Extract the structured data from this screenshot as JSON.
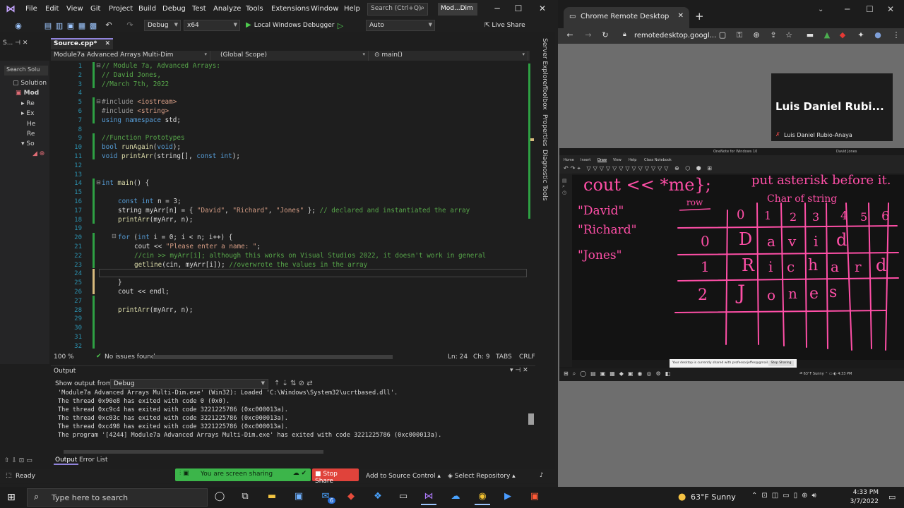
{
  "vs": {
    "menu": [
      "File",
      "Edit",
      "View",
      "Git",
      "Project",
      "Build",
      "Debug",
      "Test",
      "Analyze",
      "Tools",
      "Extensions",
      "Window",
      "Help"
    ],
    "search_placeholder": "Search (Ctrl+Q)",
    "solution_title": "Mod...Dim",
    "toolbar": {
      "config": "Debug",
      "platform": "x64",
      "run_label": "Local Windows Debugger",
      "auto": "Auto",
      "live_share": "Live Share"
    },
    "solution_tab": "S...",
    "source_tab": "Source.cpp*",
    "nav": {
      "project": "Module7a Advanced Arrays Multi-Dim",
      "scope": "(Global Scope)",
      "member": "main()"
    },
    "solution_search": "Search Solu",
    "tree": [
      "Solution",
      "Mod",
      "Re",
      "Ex",
      "He",
      "Re",
      "So"
    ],
    "side_tabs": [
      "Server Explorer",
      "Toolbox",
      "Properties",
      "Diagnostic Tools"
    ],
    "line_numbers": [
      "1",
      "2",
      "3",
      "4",
      "5",
      "6",
      "7",
      "8",
      "9",
      "10",
      "11",
      "12",
      "13",
      "14",
      "15",
      "16",
      "17",
      "18",
      "19",
      "20",
      "21",
      "22",
      "23",
      "24",
      "25",
      "26",
      "27",
      "28",
      "29",
      "30",
      "31",
      "32"
    ],
    "code": {
      "l1": "// Module 7a, Advanced Arrays:",
      "l2": "// David Jones,",
      "l3": "//March 7th, 2022",
      "l5a": "#include ",
      "l5b": "<iostream>",
      "l6a": "#include ",
      "l6b": "<string>",
      "l7a": "using namespace ",
      "l7b": "std;",
      "l9": "//Function Prototypes",
      "l10a": "bool ",
      "l10b": "runAgain",
      "l10c": "(",
      "l10d": "void",
      "l10e": ");",
      "l11a": "void ",
      "l11b": "printArr",
      "l11c": "(string[], ",
      "l11d": "const int",
      "l11e": ");",
      "l14a": "int ",
      "l14b": "main",
      "l14c": "() {",
      "l16a": "const int ",
      "l16b": "n = 3;",
      "l17a": "string myArr[n] = { ",
      "l17b": "\"David\"",
      "l17c": ", ",
      "l17d": "\"Richard\"",
      "l17e": ", ",
      "l17f": "\"Jones\"",
      "l17g": " }; ",
      "l17h": "// declared and instantiated the array",
      "l18a": "printArr",
      "l18b": "(myArr, n);",
      "l20a": "for ",
      "l20b": "(",
      "l20c": "int ",
      "l20d": "i = 0; i < n; i++) {",
      "l21a": "cout << ",
      "l21b": "\"Please enter a name: \"",
      "l21c": ";",
      "l22": "//cin >> myArr[i]; although this works on Visual Studios 2022, it doesn't work in general",
      "l23a": "getline",
      "l23b": "(cin, myArr[i]); ",
      "l23c": "//overwrote the values in the array",
      "l25": "}",
      "l26": "cout << endl;",
      "l28a": "printArr",
      "l28b": "(myArr, n);"
    },
    "editor_status": {
      "zoom": "100 %",
      "issues": "No issues found",
      "ln": "Ln: 24",
      "ch": "Ch: 9",
      "tabs": "TABS",
      "crlf": "CRLF"
    },
    "output": {
      "title": "Output",
      "show_from_label": "Show output from:",
      "source": "Debug",
      "lines": [
        "'Module7a Advanced Arrays Multi-Dim.exe' (Win32): Loaded 'C:\\Windows\\System32\\ucrtbased.dll'.",
        "The thread 0x90e8 has exited with code 0 (0x0).",
        "The thread 0xc9c4 has exited with code 3221225786 (0xc000013a).",
        "The thread 0xc03c has exited with code 3221225786 (0xc000013a).",
        "The thread 0xc498 has exited with code 3221225786 (0xc000013a).",
        "The program '[4244] Module7a Advanced Arrays Multi-Dim.exe' has exited with code 3221225786 (0xc000013a)."
      ],
      "tab_output": "Output",
      "tab_errors": "Error List"
    },
    "status": {
      "ready": "Ready",
      "sharing": "You are screen sharing",
      "stop_share": "Stop Share",
      "add_source": "Add to Source Control",
      "select_repo": "Select Repository"
    }
  },
  "chrome": {
    "tab_title": "Chrome Remote Desktop",
    "url": "remotedesktop.googl...",
    "presenter_name": "Luis Daniel Rubi...",
    "presenter_sub": "Luis Daniel Rubio-Anaya"
  },
  "onenote": {
    "title": "OneNote for Windows 10",
    "user": "David Jones",
    "menus": [
      "Home",
      "Insert",
      "Draw",
      "View",
      "Help",
      "Class Notebook"
    ],
    "notice": "Your desktop is currently shared with professorjeffes@gmail.com",
    "notice_btn": "Stop Sharing",
    "ink": {
      "cout": "cout << *me};",
      "put": "put asterisk before it.",
      "char_of": "Char of string",
      "david": "\"David\"",
      "richard": "\"Richard\"",
      "jones": "\"Jones\"",
      "row": "row",
      "cols": [
        "0",
        "1",
        "2",
        "3",
        "4",
        "5",
        "6"
      ],
      "rows": [
        "0",
        "1",
        "2"
      ],
      "r0": [
        "D",
        "a",
        "v",
        "i",
        "d"
      ],
      "r1": [
        "R",
        "i",
        "c",
        "h",
        "a",
        "r",
        "d"
      ],
      "r2": [
        "J",
        "o",
        "n",
        "e",
        "s"
      ]
    }
  },
  "taskbar": {
    "search": "Type here to search",
    "weather": "63°F  Sunny",
    "time": "4:33 PM",
    "date": "3/7/2022",
    "badge": "6"
  },
  "colors": {
    "accent": "#9184dc",
    "ink": "#ff4fa7",
    "share_green": "#3cb54a",
    "stop_red": "#e0433b"
  }
}
